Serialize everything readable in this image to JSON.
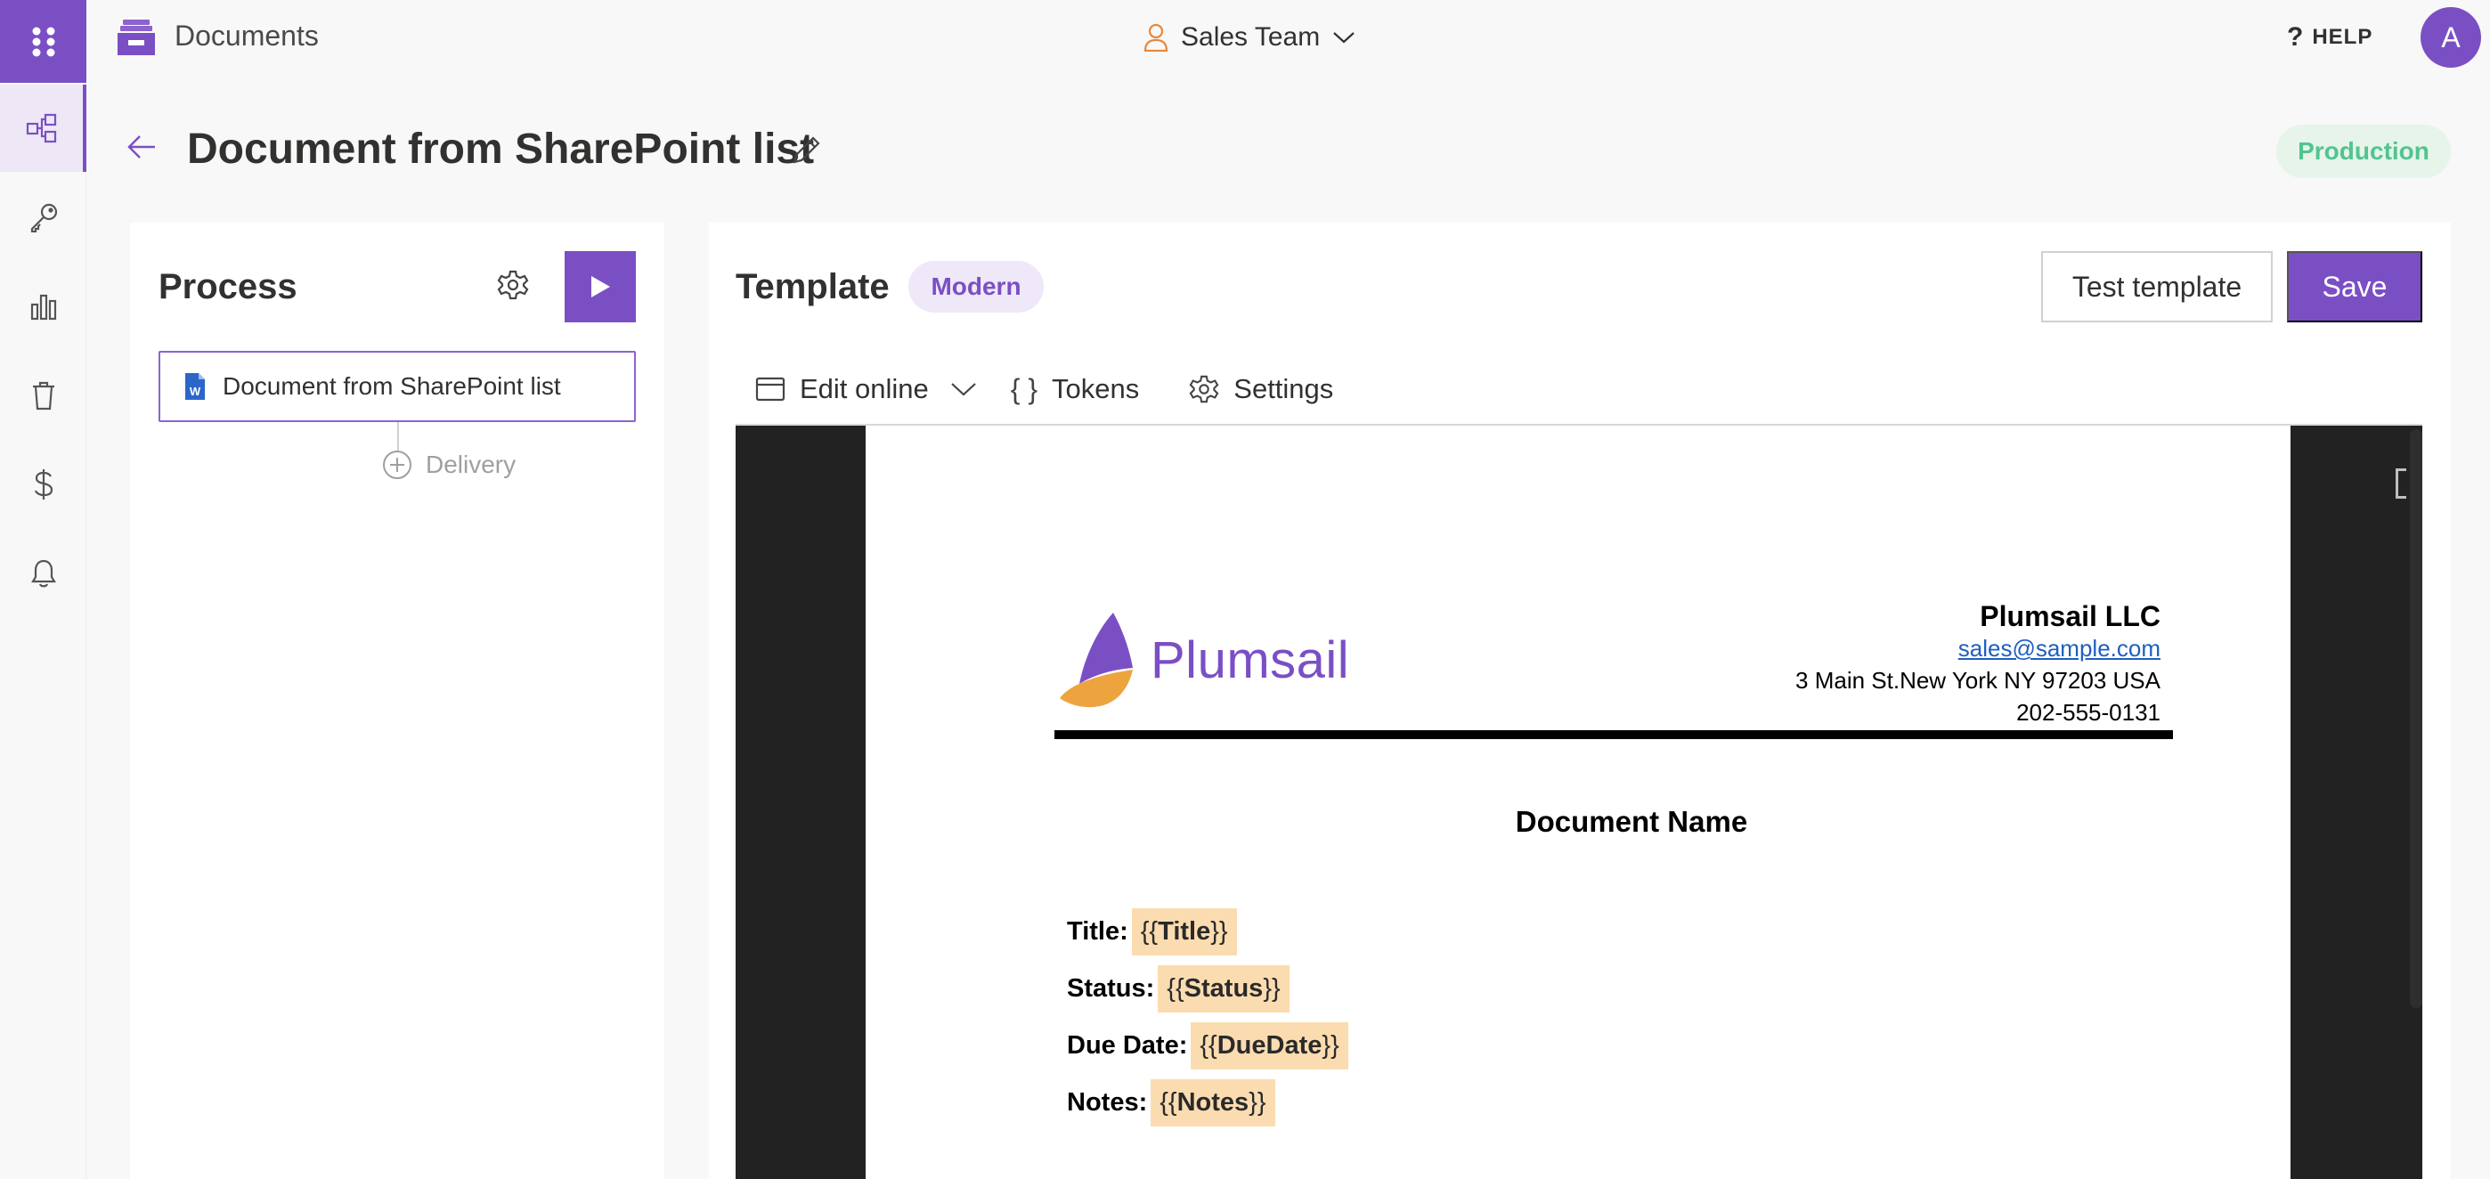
{
  "app": {
    "name": "Documents"
  },
  "team": {
    "name": "Sales Team"
  },
  "help": {
    "label": "HELP"
  },
  "user": {
    "initial": "A"
  },
  "rail": {
    "items": [
      {
        "icon": "flow-icon"
      },
      {
        "icon": "key-icon"
      },
      {
        "icon": "chart-icon"
      },
      {
        "icon": "trash-icon"
      },
      {
        "icon": "dollar-icon"
      },
      {
        "icon": "bell-icon"
      }
    ]
  },
  "page": {
    "title": "Document from SharePoint list",
    "environment": "Production"
  },
  "process": {
    "title": "Process",
    "step_label": "Document from SharePoint list",
    "delivery_label": "Delivery"
  },
  "template": {
    "title": "Template",
    "badge": "Modern",
    "test_label": "Test template",
    "save_label": "Save",
    "toolbar": {
      "edit_online": "Edit online",
      "tokens": "Tokens",
      "settings": "Settings"
    }
  },
  "document": {
    "logo_text": "Plumsail",
    "company_name": "Plumsail LLC",
    "email": "sales@sample.com",
    "address": "3 Main St.New York NY 97203 USA",
    "phone": "202-555-0131",
    "doc_name": "Document Name",
    "fields": [
      {
        "label": "Title:",
        "token": "Title"
      },
      {
        "label": "Status:",
        "token": "Status"
      },
      {
        "label": "Due Date:",
        "token": "DueDate"
      },
      {
        "label": "Notes:",
        "token": "Notes"
      }
    ]
  },
  "colors": {
    "accent": "#7b4fc4",
    "production_badge_bg": "#e6f4ea",
    "production_badge_text": "#52c490",
    "token_highlight": "#fbdcb0"
  }
}
